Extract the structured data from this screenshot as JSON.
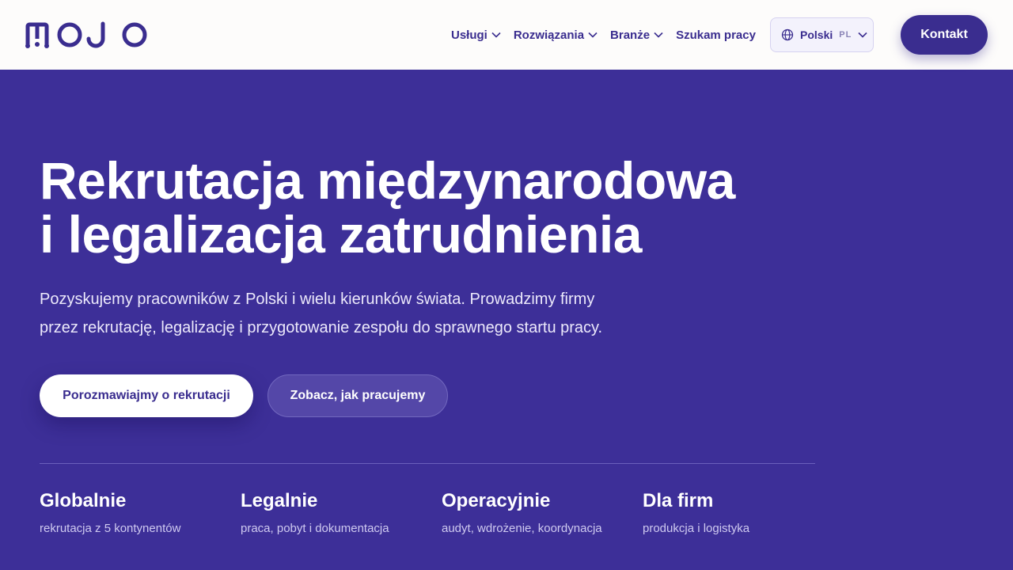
{
  "brand": {
    "name": "MOJO",
    "color": "#3a2d8f",
    "bg": "#3d2f98"
  },
  "nav": {
    "items": [
      {
        "label": "Usługi",
        "has_dropdown": true
      },
      {
        "label": "Rozwiązania",
        "has_dropdown": true
      },
      {
        "label": "Branże",
        "has_dropdown": true
      },
      {
        "label": "Szukam pracy",
        "has_dropdown": false
      }
    ],
    "language": {
      "name": "Polski",
      "code": "PL",
      "icon": "globe-icon"
    },
    "contact_label": "Kontakt"
  },
  "hero": {
    "title_line1": "Rekrutacja międzynarodowa",
    "title_line2": "i legalizacja zatrudnienia",
    "subtitle_line1": "Pozyskujemy pracowników z Polski i wielu kierunków świata. Prowadzimy firmy",
    "subtitle_line2": "przez rekrutację, legalizację i przygotowanie zespołu do sprawnego startu pracy.",
    "primary_cta": "Porozmawiajmy o rekrutacji",
    "secondary_cta": "Zobacz, jak pracujemy"
  },
  "features": [
    {
      "title": "Globalnie",
      "desc": "rekrutacja z 5 kontynentów"
    },
    {
      "title": "Legalnie",
      "desc": "praca, pobyt i dokumentacja"
    },
    {
      "title": "Operacyjnie",
      "desc": "audyt, wdrożenie, koordynacja"
    },
    {
      "title": "Dla firm",
      "desc": "produkcja i logistyka"
    }
  ]
}
